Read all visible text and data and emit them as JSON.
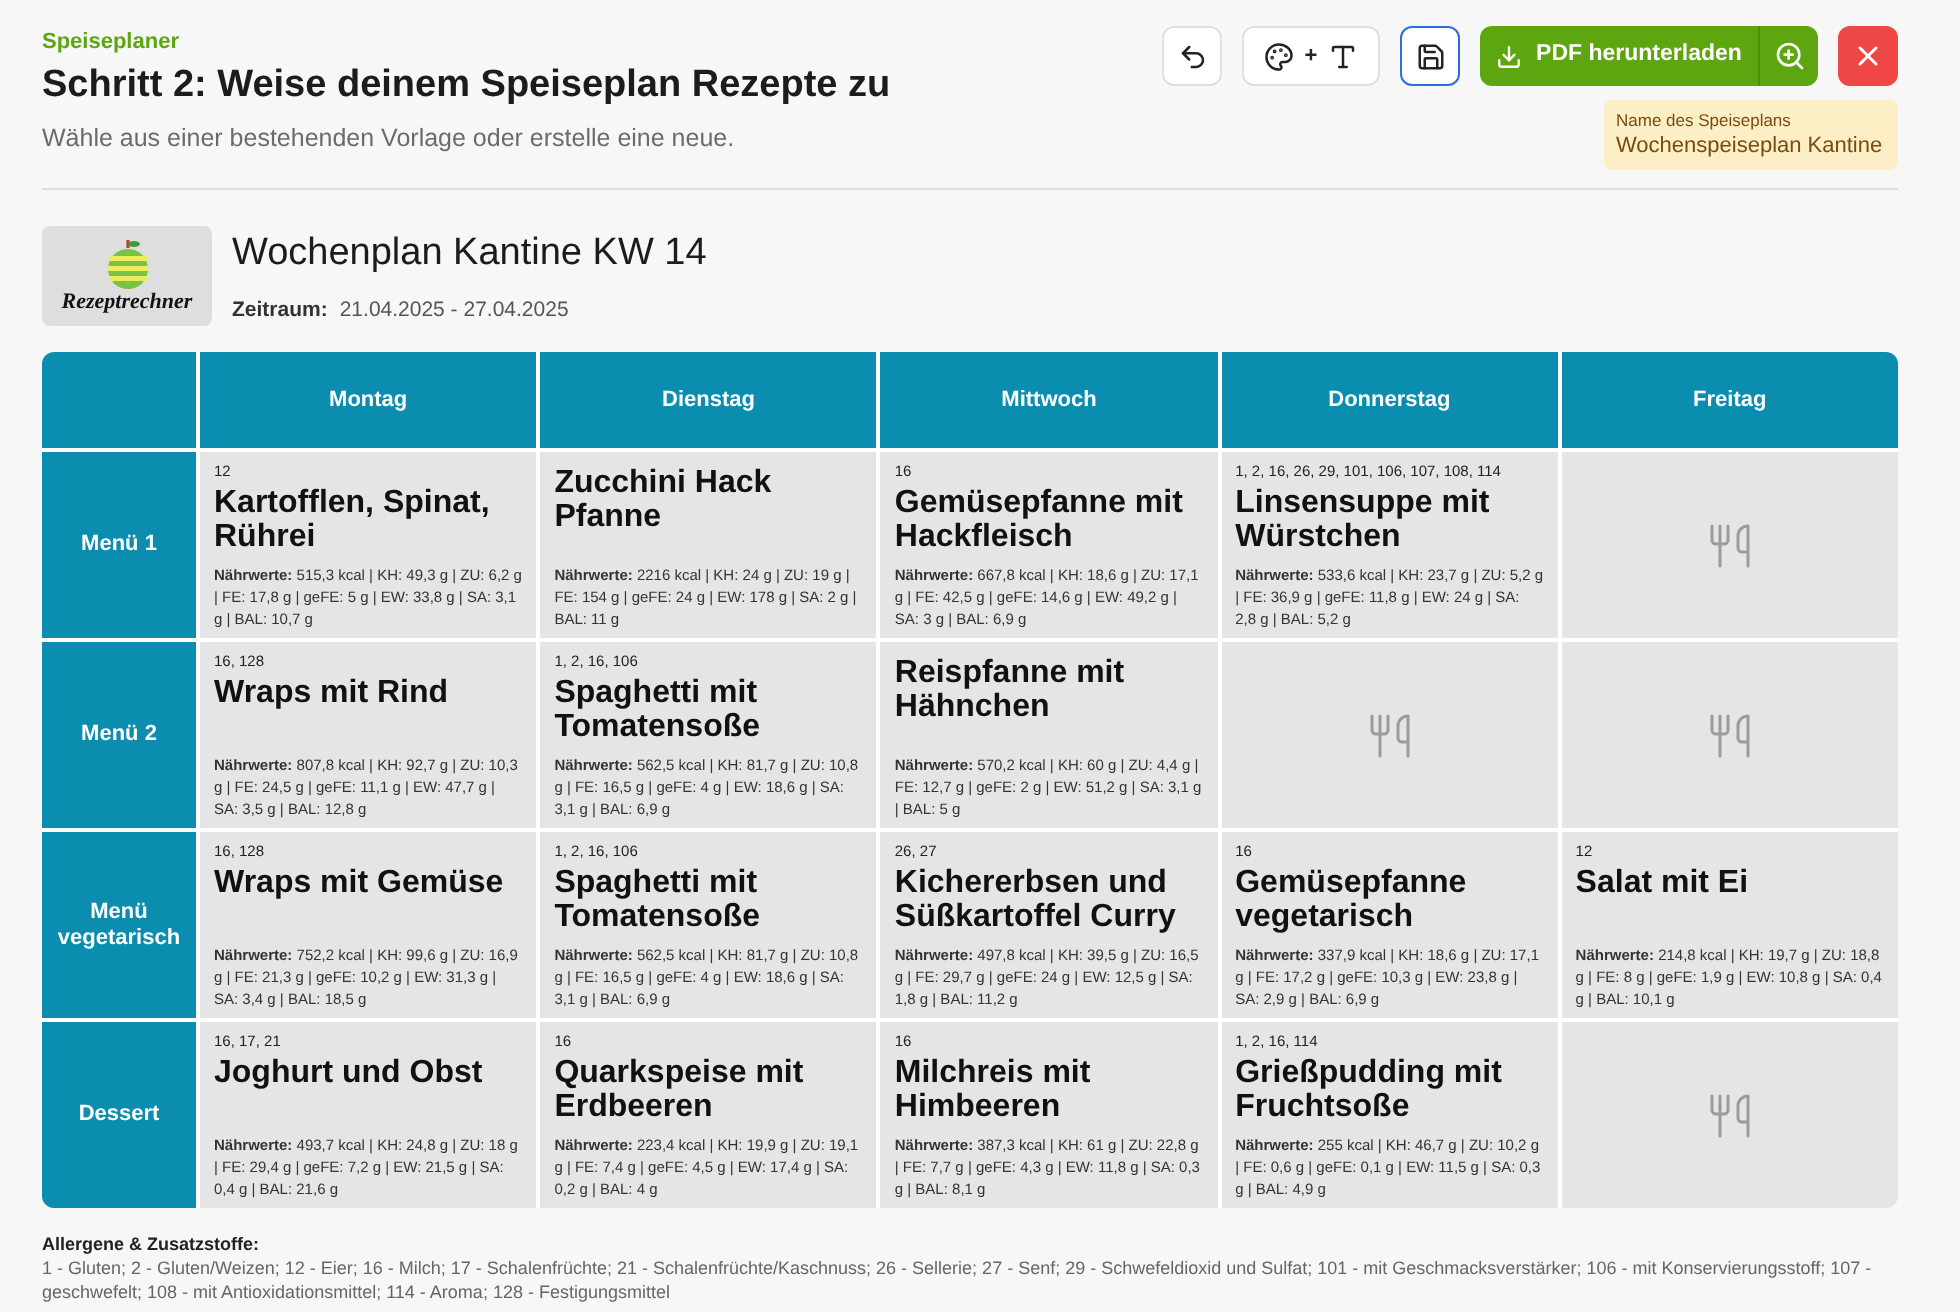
{
  "header": {
    "breadcrumb": "Speiseplaner",
    "title": "Schritt 2: Weise deinem Speiseplan Rezepte zu",
    "subtitle": "Wähle aus einer bestehenden Vorlage oder erstelle eine neue."
  },
  "toolbar": [
    {
      "kind": "undo"
    },
    {
      "kind": "style",
      "text": "+"
    },
    {
      "kind": "save",
      "focused": true
    },
    {
      "kind": "pdf",
      "label": "PDF herunterladen"
    },
    {
      "kind": "close"
    }
  ],
  "plan_name": {
    "label": "Name des Speiseplans",
    "value": "Wochenspeiseplan Kantine"
  },
  "plan": {
    "logo_text": "Rezeptrechner",
    "title": "Wochenplan Kantine KW 14",
    "period_label": "Zeitraum:",
    "period": "21.04.2025 - 27.04.2025"
  },
  "table": {
    "columns": [
      "Montag",
      "Dienstag",
      "Mittwoch",
      "Donnerstag",
      "Freitag"
    ],
    "rows": [
      {
        "label": "Menü 1",
        "cells": [
          {
            "kind": "recipe",
            "allergens": "12",
            "name": "Kartofflen, Spinat, Rührei",
            "nutrition": "**Nährwerte:** 515,3 kcal | KH: 49,3 g | ZU: 6,2 g | FE: 17,8 g | geFE: 5 g | EW: 33,8 g | SA: 3,1 g | BAL: 10,7 g"
          },
          {
            "kind": "recipe",
            "name": "Zucchini Hack Pfanne",
            "nutrition": "**Nährwerte:** 2216 kcal | KH: 24 g | ZU: 19 g | FE: 154 g | geFE: 24 g | EW: 178 g | SA: 2 g | BAL: 11 g"
          },
          {
            "kind": "recipe",
            "allergens": "16",
            "name": "Gemüsepfanne mit Hackfleisch",
            "nutrition": "**Nährwerte:** 667,8 kcal | KH: 18,6 g | ZU: 17,1 g | FE: 42,5 g | geFE: 14,6 g | EW: 49,2 g | SA: 3 g | BAL: 6,9 g"
          },
          {
            "kind": "recipe",
            "allergens": "1, 2, 16, 26, 29, 101, 106, 107, 108, 114",
            "name": "Linsensuppe mit Würstchen",
            "nutrition": "**Nährwerte:** 533,6 kcal | KH: 23,7 g | ZU: 5,2 g | FE: 36,9 g | geFE: 11,8 g | EW: 24 g | SA: 2,8 g | BAL: 5,2 g"
          },
          {
            "kind": "empty"
          }
        ]
      },
      {
        "label": "Menü 2",
        "cells": [
          {
            "kind": "recipe",
            "allergens": "16, 128",
            "name": "Wraps mit Rind",
            "nutrition": "**Nährwerte:** 807,8 kcal | KH: 92,7 g | ZU: 10,3 g | FE: 24,5 g | geFE: 11,1 g | EW: 47,7 g | SA: 3,5 g | BAL: 12,8 g"
          },
          {
            "kind": "recipe",
            "allergens": "1, 2, 16, 106",
            "name": "Spaghetti mit Tomatensoße",
            "nutrition": "**Nährwerte:** 562,5 kcal | KH: 81,7 g | ZU: 10,8 g | FE: 16,5 g | geFE: 4 g | EW: 18,6 g | SA: 3,1 g | BAL: 6,9 g"
          },
          {
            "kind": "recipe",
            "name": "Reispfanne mit Hähnchen",
            "nutrition": "**Nährwerte:** 570,2 kcal | KH: 60 g | ZU: 4,4 g | FE: 12,7 g | geFE: 2 g | EW: 51,2 g | SA: 3,1 g | BAL: 5 g"
          },
          {
            "kind": "empty"
          },
          {
            "kind": "empty"
          }
        ]
      },
      {
        "label": "Menü vegetarisch",
        "cells": [
          {
            "kind": "recipe",
            "allergens": "16, 128",
            "name": "Wraps mit Gemüse",
            "nutrition": "**Nährwerte:** 752,2 kcal | KH: 99,6 g | ZU: 16,9 g | FE: 21,3 g | geFE: 10,2 g | EW: 31,3 g | SA: 3,4 g | BAL: 18,5 g"
          },
          {
            "kind": "recipe",
            "allergens": "1, 2, 16, 106",
            "name": "Spaghetti mit Tomatensoße",
            "nutrition": "**Nährwerte:** 562,5 kcal | KH: 81,7 g | ZU: 10,8 g | FE: 16,5 g | geFE: 4 g | EW: 18,6 g | SA: 3,1 g | BAL: 6,9 g"
          },
          {
            "kind": "recipe",
            "allergens": "26, 27",
            "name": "Kichererbsen und Süßkartoffel Curry",
            "nutrition": "**Nährwerte:** 497,8 kcal | KH: 39,5 g | ZU: 16,5 g | FE: 29,7 g | geFE: 24 g | EW: 12,5 g | SA: 1,8 g | BAL: 11,2 g"
          },
          {
            "kind": "recipe",
            "allergens": "16",
            "name": "Gemüsepfanne vegetarisch",
            "nutrition": "**Nährwerte:** 337,9 kcal | KH: 18,6 g | ZU: 17,1 g | FE: 17,2 g | geFE: 10,3 g | EW: 23,8 g | SA: 2,9 g | BAL: 6,9 g"
          },
          {
            "kind": "recipe",
            "allergens": "12",
            "name": "Salat mit Ei",
            "nutrition": "**Nährwerte:** 214,8 kcal | KH: 19,7 g | ZU: 18,8 g | FE: 8 g | geFE: 1,9 g | EW: 10,8 g | SA: 0,4 g | BAL: 10,1 g"
          }
        ]
      },
      {
        "label": "Dessert",
        "cells": [
          {
            "kind": "recipe",
            "allergens": "16, 17, 21",
            "name": "Joghurt und Obst",
            "nutrition": "**Nährwerte:** 493,7 kcal | KH: 24,8 g | ZU: 18 g | FE: 29,4 g | geFE: 7,2 g | EW: 21,5 g | SA: 0,4 g | BAL: 21,6 g"
          },
          {
            "kind": "recipe",
            "allergens": "16",
            "name": "Quarkspeise mit Erdbeeren",
            "nutrition": "**Nährwerte:** 223,4 kcal | KH: 19,9 g | ZU: 19,1 g | FE: 7,4 g | geFE: 4,5 g | EW: 17,4 g | SA: 0,2 g | BAL: 4 g"
          },
          {
            "kind": "recipe",
            "allergens": "16",
            "name": "Milchreis mit Himbeeren",
            "nutrition": "**Nährwerte:** 387,3 kcal | KH: 61 g | ZU: 22,8 g | FE: 7,7 g | geFE: 4,3 g | EW: 11,8 g | SA: 0,3 g | BAL: 8,1 g"
          },
          {
            "kind": "recipe",
            "allergens": "1, 2, 16, 114",
            "name": "Grießpudding mit Fruchtsoße",
            "nutrition": "**Nährwerte:** 255 kcal | KH: 46,7 g | ZU: 10,2 g | FE: 0,6 g | geFE: 0,1 g | EW: 11,5 g | SA: 0,3 g | BAL: 4,9 g"
          },
          {
            "kind": "empty"
          }
        ]
      }
    ]
  },
  "legend": {
    "title": "Allergene & Zusatzstoffe:",
    "text": "1 - Gluten; 2 - Gluten/Weizen; 12 - Eier; 16 - Milch; 17 - Schalenfrüchte; 21 - Schalenfrüchte/Kaschnuss; 26 - Sellerie; 27 - Senf; 29 - Schwefeldioxid und Sulfat; 101 - mit Geschmacksverstärker; 106 - mit Konservierungsstoff; 107 - geschwefelt; 108 - mit Antioxidationsmittel; 114 - Aroma; 128 - Festigungsmittel"
  }
}
